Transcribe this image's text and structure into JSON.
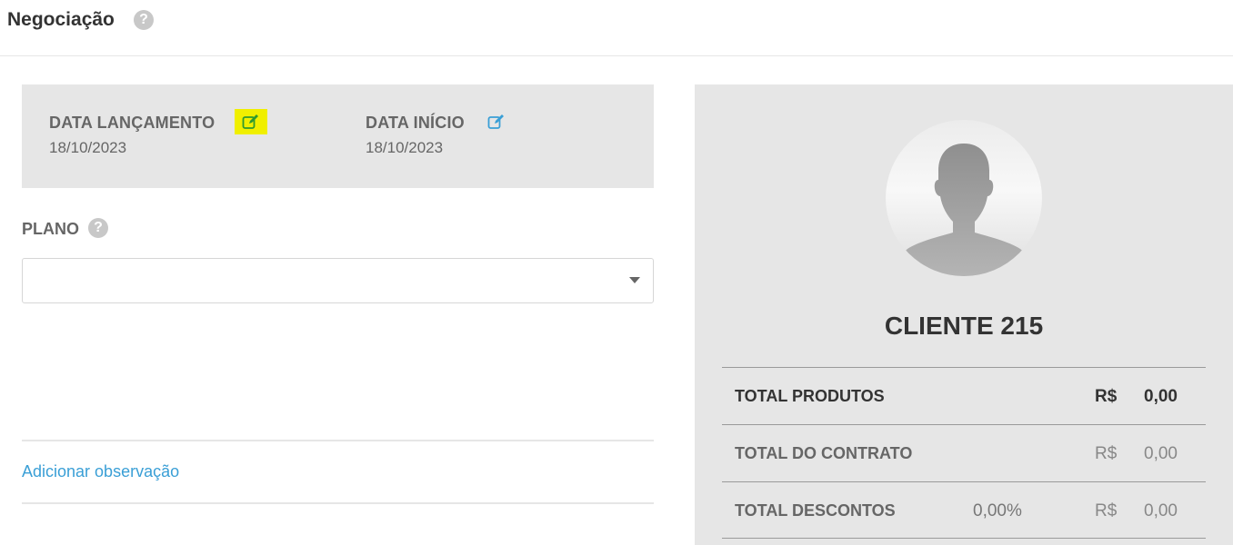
{
  "header": {
    "title": "Negociação",
    "help_glyph": "?"
  },
  "dates": {
    "launch_label": "DATA LANÇAMENTO",
    "launch_value": "18/10/2023",
    "start_label": "DATA INÍCIO",
    "start_value": "18/10/2023"
  },
  "plano": {
    "label": "PLANO",
    "help_glyph": "?",
    "selected": ""
  },
  "observation_link": "Adicionar observação",
  "client": {
    "name": "CLIENTE 215",
    "totals": [
      {
        "label": "TOTAL PRODUTOS",
        "percent": "",
        "currency": "R$",
        "value": "0,00"
      },
      {
        "label": "TOTAL DO CONTRATO",
        "percent": "",
        "currency": "R$",
        "value": "0,00"
      },
      {
        "label": "TOTAL DESCONTOS",
        "percent": "0,00%",
        "currency": "R$",
        "value": "0,00"
      }
    ]
  },
  "icons": {
    "title_help": "question-circle-icon",
    "edit_launch": "edit-icon",
    "edit_start": "edit-icon",
    "plano_help": "question-circle-icon",
    "dropdown": "caret-down-icon",
    "avatar": "user-silhouette-icon"
  },
  "colors": {
    "link": "#3a9fd6",
    "highlight": "#f0ef00",
    "edit_launch": "#2e9a2e",
    "panel_bg": "#e6e6e6"
  }
}
